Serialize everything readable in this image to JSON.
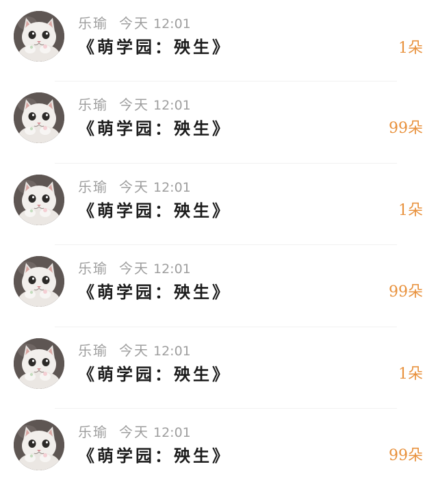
{
  "items": [
    {
      "name": "乐瑜",
      "day": "今天",
      "time": "12:01",
      "title": "《萌学园：殃生》",
      "count": "1朵"
    },
    {
      "name": "乐瑜",
      "day": "今天",
      "time": "12:01",
      "title": "《萌学园：殃生》",
      "count": "99朵"
    },
    {
      "name": "乐瑜",
      "day": "今天",
      "time": "12:01",
      "title": "《萌学园：殃生》",
      "count": "1朵"
    },
    {
      "name": "乐瑜",
      "day": "今天",
      "time": "12:01",
      "title": "《萌学园：殃生》",
      "count": "99朵"
    },
    {
      "name": "乐瑜",
      "day": "今天",
      "time": "12:01",
      "title": "《萌学园：殃生》",
      "count": "1朵"
    },
    {
      "name": "乐瑜",
      "day": "今天",
      "time": "12:01",
      "title": "《萌学园：殃生》",
      "count": "99朵"
    }
  ],
  "colors": {
    "meta_text": "#9e9e9e",
    "title_text": "#1c1c1c",
    "count_accent": "#e8913c"
  },
  "icons": {
    "avatar": "white-cat-avatar"
  }
}
